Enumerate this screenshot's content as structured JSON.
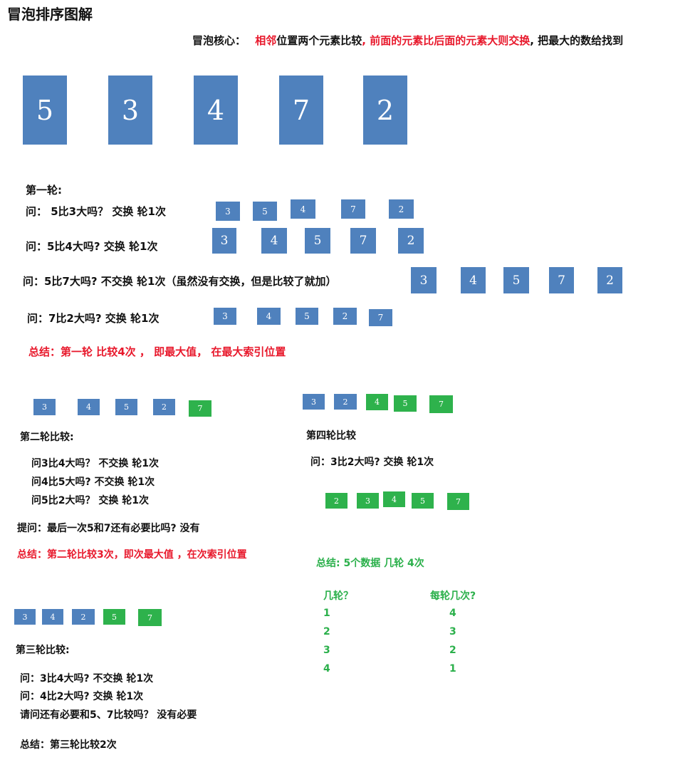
{
  "title": "冒泡排序图解",
  "core": {
    "label": "冒泡核心：",
    "p1": "相邻",
    "p2": "位置两个元素比较",
    "p3": ", 前面的元素比后面的元素大则交换",
    "p4": ", 把最大的数给找到"
  },
  "initial": [
    "5",
    "3",
    "4",
    "7",
    "2"
  ],
  "round1": {
    "title": "第一轮:",
    "steps": [
      {
        "text": "问：  5比3大吗？  交换      轮1次",
        "cells": [
          "3",
          "5",
          "4",
          "7",
          "2"
        ]
      },
      {
        "text": "问：5比4大吗?   交换       轮1次",
        "cells": [
          "3",
          "4",
          "5",
          "7",
          "2"
        ]
      },
      {
        "text": "问：5比7大吗?    不交换   轮1次（虽然没有交换，但是比较了就加）",
        "cells": [
          "3",
          "4",
          "5",
          "7",
          "2"
        ]
      },
      {
        "text": "问：7比2大吗?   交换    轮1次",
        "cells": [
          "3",
          "4",
          "5",
          "2",
          "7"
        ]
      }
    ],
    "summary": "总结：第一轮  比较4次 ，  即最大值，  在最大索引位置"
  },
  "round2": {
    "cells": [
      "3",
      "4",
      "5",
      "2",
      "7"
    ],
    "title": "第二轮比较:",
    "q1": "问3比4大吗？     不交换        轮1次",
    "q2": "问4比5大吗?      不交换        轮1次",
    "q3": "问5比2大吗？   交换            轮1次",
    "tip": "提问：最后一次5和7还有必要比吗?    没有",
    "summary": "总结：第二轮比较3次，即次最大值 ，在次索引位置"
  },
  "round3": {
    "cells": [
      "3",
      "4",
      "2",
      "5",
      "7"
    ],
    "title": "第三轮比较:",
    "q1": "问：3比4大吗?     不交换    轮1次",
    "q2": "问：4比2大吗?      交换       轮1次",
    "q3": "请问还有必要和5、7比较吗？  没有必要",
    "summary": "总结：第三轮比较2次"
  },
  "round4": {
    "cells_before": [
      "3",
      "2",
      "4",
      "5",
      "7"
    ],
    "title": "第四轮比较",
    "q1": "问：3比2大吗?     交换       轮1次",
    "cells_after": [
      "2",
      "3",
      "4",
      "5",
      "7"
    ]
  },
  "final": {
    "summary": "总结:    5个数据    几轮 4次",
    "col1": "几轮？",
    "col2": "每轮几次?",
    "rows": [
      [
        "1",
        "4"
      ],
      [
        "2",
        "3"
      ],
      [
        "3",
        "2"
      ],
      [
        "4",
        "1"
      ]
    ]
  },
  "colors": {
    "blue": "#4f81bd",
    "green": "#2eb24c",
    "red": "#e8192c",
    "textgreen": "#2bb04b"
  }
}
